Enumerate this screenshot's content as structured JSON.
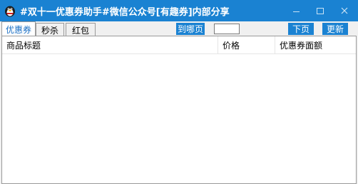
{
  "window": {
    "title": "#双十一优惠券助手#微信公众号[有趣券]内部分享",
    "controls": [
      "minimize",
      "maximize",
      "close"
    ]
  },
  "tabs": [
    {
      "label": "优惠券",
      "active": true
    },
    {
      "label": "秒杀",
      "active": false
    },
    {
      "label": "红包",
      "active": false
    }
  ],
  "toolbar": {
    "goto_label": "到哪页",
    "page_input_value": "",
    "next_label": "下页",
    "refresh_label": "更新"
  },
  "table": {
    "columns": [
      "商品标题",
      "价格",
      "优惠券面额"
    ],
    "rows": []
  },
  "colors": {
    "accent": "#1a82d2",
    "active_tab_text": "#1a6fc4"
  }
}
